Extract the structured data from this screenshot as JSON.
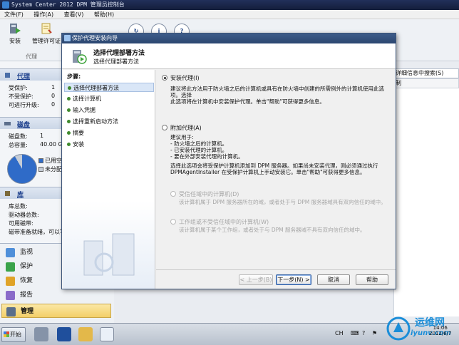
{
  "window": {
    "title": "System Center 2012 DPM 管理员控制台"
  },
  "menu": [
    "文件(F)",
    "操作(A)",
    "查看(V)",
    "帮助(H)"
  ],
  "ribbon": {
    "install_label": "安装",
    "license_label": "管理许可证",
    "group_label": "代理"
  },
  "search_hint": "详细信息中搜索(S)",
  "column_header": "制",
  "agents": {
    "title": "代理",
    "rows": [
      {
        "label": "受保护:",
        "value": "1"
      },
      {
        "label": "不受保护:",
        "value": "0"
      },
      {
        "label": "可进行升级:",
        "value": "0"
      }
    ]
  },
  "disk": {
    "title": "磁盘",
    "rows": [
      {
        "label": "磁盘数:",
        "value": "1"
      },
      {
        "label": "总容量:",
        "value": "40.00 GB"
      }
    ],
    "legend_used": "已用空",
    "legend_unallocated": "未分配"
  },
  "library": {
    "title": "库",
    "rows": [
      "库总数:",
      "驱动器总数:",
      "可用磁带:",
      "磁带准备就绪，可以写"
    ]
  },
  "nav": [
    "监视",
    "保护",
    "恢复",
    "报告",
    "管理"
  ],
  "dialog": {
    "title": "保护代理安装向导",
    "header_title": "选择代理部署方法",
    "header_subtitle": "选择代理部署方法",
    "steps_title": "步骤:",
    "steps": [
      "选择代理部署方法",
      "选择计算机",
      "输入凭据",
      "选择重新启动方法",
      "摘要",
      "安装"
    ],
    "option1_label": "安装代理(I)",
    "option1_desc": "建议将此方法用于防火墙之后的计算机或具有在防火墙中创建的所需例外的计算机使用此选项。选择\n此选项将在计算机中安装保护代理。单击\"帮助\"可获得更多信息。",
    "option2_label": "附加代理(A)",
    "option2_desc": "建议用于:\n- 防火墙之后的计算机。\n- 已安装代理的计算机。\n- 要在外部安装代理的计算机。",
    "option2_desc2": "选择此选项会将受保护计算机添加到 DPM 服务器。如果尚未安装代理，则必须通过执行\nDPMAgentInstaller 在受保护计算机上手动安装它。单击\"帮助\"可获得更多信息。",
    "sub1_label": "受信任域中的计算机(D)",
    "sub1_desc": "该计算机属于 DPM 服务器所在的域，或者处于与 DPM 服务器域具有双向信任的域中。",
    "sub2_label": "工作组或不受信任域中的计算机(W)",
    "sub2_desc": "该计算机属于某个工作组，或者处于与 DPM 服务器域不具有双向信任的域中。",
    "btn_back": "< 上一步(B)",
    "btn_next": "下一步(N) >",
    "btn_cancel": "取消",
    "btn_help": "帮助"
  },
  "taskbar": {
    "start": "开始",
    "lang": "CH",
    "time": "14:06",
    "date": "2012/6/7"
  },
  "watermark": {
    "line1": "运维网",
    "line2": "iyunv.com"
  }
}
